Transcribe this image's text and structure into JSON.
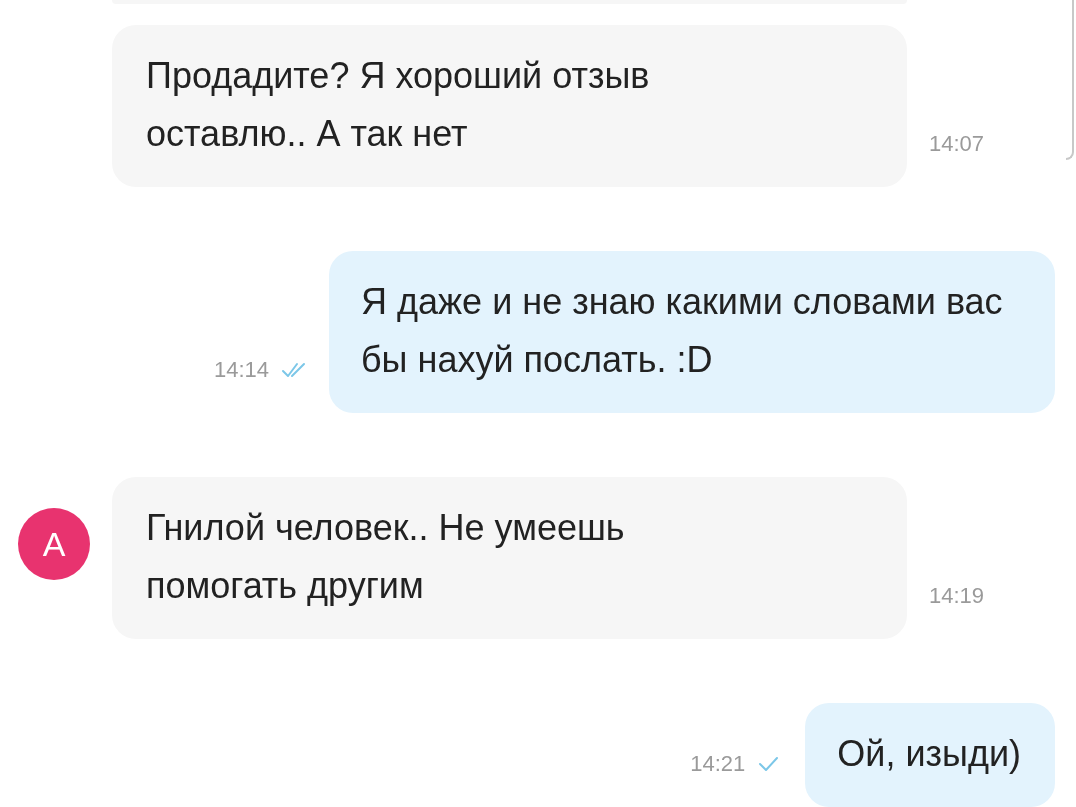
{
  "messages": [
    {
      "kind": "incoming",
      "text": "Продадите? Я хороший отзыв оставлю.. А так нет",
      "time": "14:07"
    },
    {
      "kind": "outgoing",
      "text": "Я даже и не знаю какими словами вас бы нахуй послать. :D",
      "time": "14:14",
      "read": true
    },
    {
      "kind": "incoming",
      "avatar": "A",
      "text": "Гнилой человек.. Не умеешь помогать другим",
      "time": "14:19"
    },
    {
      "kind": "outgoing",
      "text": "Ой, изыди)",
      "time": "14:21",
      "read": false
    }
  ]
}
